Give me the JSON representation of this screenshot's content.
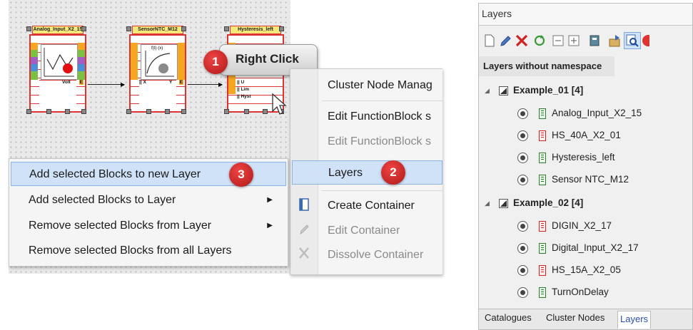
{
  "canvas": {
    "blocks": [
      {
        "title": "Analog_Input_X2_15",
        "port_right": "Volt",
        "port_right_letter": "E"
      },
      {
        "title": "SensorNTC_M12",
        "port_left": "|| X",
        "port_right": "Y",
        "port_right_letter": "E",
        "pic_label": "f(t)·(x)"
      },
      {
        "title": "Hysteresis_left",
        "ports_left": [
          "|| U",
          "|| Lim",
          "|| Hyst"
        ]
      }
    ],
    "callout": {
      "text": "Right Click",
      "badge": "1"
    }
  },
  "left_menu": {
    "items": [
      {
        "label": "Add selected Blocks to new Layer",
        "highlighted": true,
        "badge": "3"
      },
      {
        "label": "Add selected Blocks to Layer",
        "submenu": true
      },
      {
        "label": "Remove selected Blocks from Layer",
        "submenu": true
      },
      {
        "label": "Remove selected Blocks from all Layers"
      }
    ],
    "submenu_arrow": "▶"
  },
  "right_menu": {
    "items": [
      {
        "label": "Cluster Node Manag"
      },
      {
        "label": "Edit FunctionBlock s"
      },
      {
        "label": "Edit FunctionBlock s",
        "disabled": true
      },
      {
        "label": "Layers",
        "highlighted": true,
        "badge": "2"
      },
      {
        "label": "Create Container",
        "icon": "container-icon"
      },
      {
        "label": "Edit Container",
        "disabled": true,
        "icon": "pencil-icon"
      },
      {
        "label": "Dissolve Container",
        "disabled": true,
        "icon": "x-icon"
      }
    ]
  },
  "layers_panel": {
    "title": "Layers",
    "section": "Layers without namespace",
    "groups": [
      {
        "label": "Example_01 [4]",
        "items": [
          {
            "label": "Analog_Input_X2_15",
            "color": "green"
          },
          {
            "label": "HS_40A_X2_01",
            "color": "red"
          },
          {
            "label": "Hysteresis_left",
            "color": "green"
          },
          {
            "label": "Sensor NTC_M12",
            "color": "green"
          }
        ]
      },
      {
        "label": "Example_02 [4]",
        "items": [
          {
            "label": "DIGIN_X2_17",
            "color": "red"
          },
          {
            "label": "Digital_Input_X2_17",
            "color": "green"
          },
          {
            "label": "HS_15A_X2_05",
            "color": "red"
          },
          {
            "label": "TurnOnDelay",
            "color": "green"
          }
        ]
      }
    ],
    "tabs": [
      "Catalogues",
      "Cluster Nodes",
      "Layers"
    ],
    "active_tab": "Layers"
  },
  "colors": {
    "badge": "#c41f1f",
    "highlight": "#cfe2f7",
    "block_border": "#dd3333",
    "block_title": "#f6e87a"
  }
}
